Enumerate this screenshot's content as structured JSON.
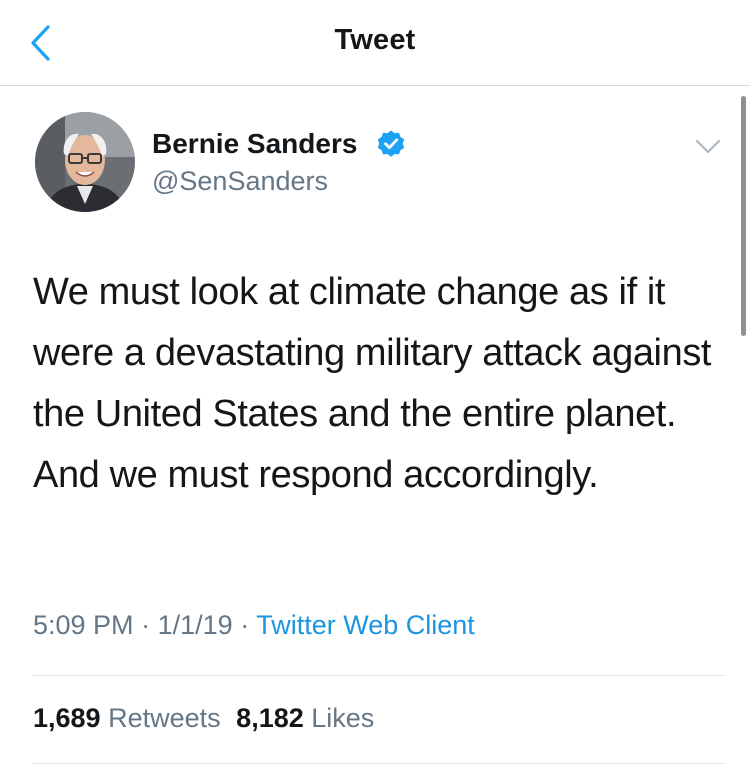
{
  "nav": {
    "title": "Tweet",
    "back_icon": "chevron-left-icon"
  },
  "author": {
    "name": "Bernie Sanders",
    "handle": "@SenSanders",
    "verified": true
  },
  "tweet": {
    "text": "We must look at climate change as if it were a devastating military attack against the United States and the entire planet. And we must respond accordingly.",
    "time": "5:09 PM",
    "separator": "·",
    "date": "1/1/19",
    "client": "Twitter Web Client"
  },
  "stats": {
    "retweets_count": "1,689",
    "retweets_label": "Retweets",
    "likes_count": "8,182",
    "likes_label": "Likes"
  },
  "colors": {
    "accent": "#1b95e0",
    "secondary_text": "#657786",
    "primary_text": "#14171a",
    "divider": "#e1e8ed"
  }
}
